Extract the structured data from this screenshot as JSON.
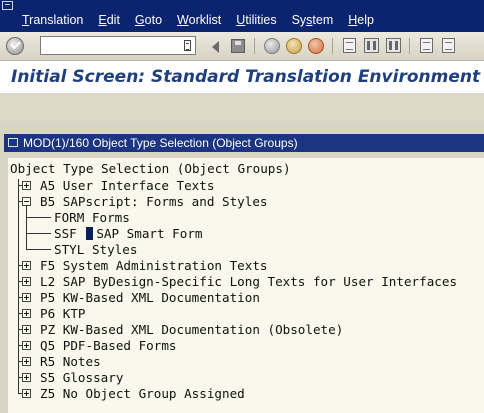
{
  "menu": {
    "items": [
      {
        "pre": "",
        "mn": "T",
        "post": "ranslation"
      },
      {
        "pre": "",
        "mn": "E",
        "post": "dit"
      },
      {
        "pre": "",
        "mn": "G",
        "post": "oto"
      },
      {
        "pre": "",
        "mn": "W",
        "post": "orklist"
      },
      {
        "pre": "",
        "mn": "U",
        "post": "tilities"
      },
      {
        "pre": "Sy",
        "mn": "s",
        "post": "tem"
      },
      {
        "pre": "",
        "mn": "H",
        "post": "elp"
      }
    ]
  },
  "toolbar": {
    "command_value": "",
    "icons": [
      "enter-icon",
      "back-arrow-icon",
      "save-icon",
      "back-icon",
      "exit-icon",
      "cancel-icon",
      "print-icon",
      "find-icon",
      "find-next-icon",
      "first-page-icon",
      "previous-page-icon"
    ]
  },
  "page": {
    "title": "Initial Screen: Standard Translation Environment"
  },
  "popup": {
    "title": "MOD(1)/160 Object Type Selection (Object Groups)",
    "tree_header": "Object Type Selection (Object Groups)",
    "nodes": [
      {
        "code": "A5",
        "text": "User Interface Texts",
        "expanded": false
      },
      {
        "code": "B5",
        "text": "SAPscript: Forms and Styles",
        "expanded": true,
        "children": [
          {
            "code": "FORM",
            "text": "Forms"
          },
          {
            "code": "SSF",
            "text": "SAP Smart Form",
            "selected": true
          },
          {
            "code": "STYL",
            "text": "Styles"
          }
        ]
      },
      {
        "code": "F5",
        "text": "System Administration Texts",
        "expanded": false
      },
      {
        "code": "L2",
        "text": "SAP ByDesign-Specific Long Texts for User Interfaces",
        "expanded": false
      },
      {
        "code": "P5",
        "text": "KW-Based XML Documentation",
        "expanded": false
      },
      {
        "code": "P6",
        "text": "KTP",
        "expanded": false
      },
      {
        "code": "PZ",
        "text": "KW-Based XML Documentation (Obsolete)",
        "expanded": false
      },
      {
        "code": "Q5",
        "text": "PDF-Based Forms",
        "expanded": false
      },
      {
        "code": "R5",
        "text": "Notes",
        "expanded": false
      },
      {
        "code": "S5",
        "text": "Glossary",
        "expanded": false
      },
      {
        "code": "Z5",
        "text": "No Object Group Assigned",
        "expanded": false
      }
    ]
  }
}
